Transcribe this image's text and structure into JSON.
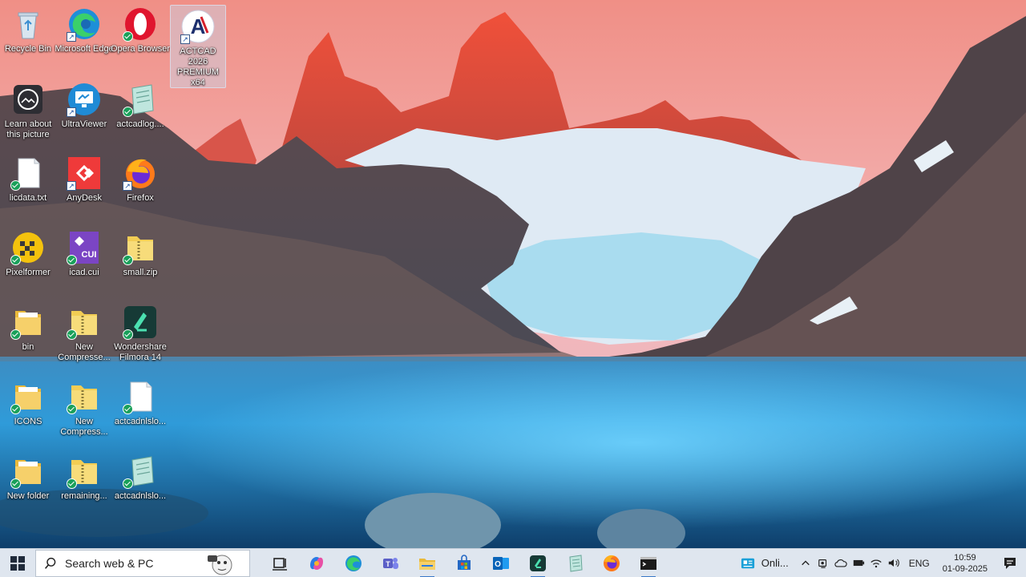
{
  "desktop": {
    "icons": [
      {
        "label": "Recycle Bin",
        "icon": "recycle-bin-icon"
      },
      {
        "label": "Microsoft Edge",
        "icon": "edge-icon"
      },
      {
        "label": "Opera Browser",
        "icon": "opera-icon"
      },
      {
        "label": "ACTCAD 2026 PREMIUM x64",
        "icon": "actcad-icon"
      },
      {
        "label": "Learn about this picture",
        "icon": "learn-picture-icon"
      },
      {
        "label": "UltraViewer",
        "icon": "ultraviewer-icon"
      },
      {
        "label": "actcadlog....",
        "icon": "notepad-file-icon"
      },
      {
        "label": "licdata.txt",
        "icon": "text-file-icon"
      },
      {
        "label": "AnyDesk",
        "icon": "anydesk-icon"
      },
      {
        "label": "Firefox",
        "icon": "firefox-icon"
      },
      {
        "label": "Pixelformer",
        "icon": "pixelformer-icon"
      },
      {
        "label": "icad.cui",
        "icon": "cui-file-icon"
      },
      {
        "label": "small.zip",
        "icon": "zip-folder-icon"
      },
      {
        "label": "bin",
        "icon": "folder-icon"
      },
      {
        "label": "New Compresse...",
        "icon": "zip-folder-icon"
      },
      {
        "label": "Wondershare Filmora 14",
        "icon": "filmora-icon"
      },
      {
        "label": "ICONS",
        "icon": "folder-icon"
      },
      {
        "label": "New Compress...",
        "icon": "zip-folder-icon"
      },
      {
        "label": "actcadnlslo...",
        "icon": "text-file-icon"
      },
      {
        "label": "New folder",
        "icon": "folder-icon"
      },
      {
        "label": "remaining...",
        "icon": "zip-folder-icon"
      },
      {
        "label": "actcadnlslo...",
        "icon": "notepad-file-icon"
      }
    ],
    "actcad_logo_letter": "A"
  },
  "taskbar": {
    "search_placeholder": "Search web & PC",
    "apps": [
      "task-view-icon",
      "copilot-icon",
      "edge-icon",
      "teams-icon",
      "file-explorer-icon",
      "store-icon",
      "outlook-icon",
      "filmora-icon",
      "notepad-icon",
      "firefox-icon",
      "terminal-icon"
    ],
    "widget_label": "Onli...",
    "language": "ENG",
    "time": "10:59",
    "date": "01-09-2025",
    "accent": "#3a78c8"
  }
}
